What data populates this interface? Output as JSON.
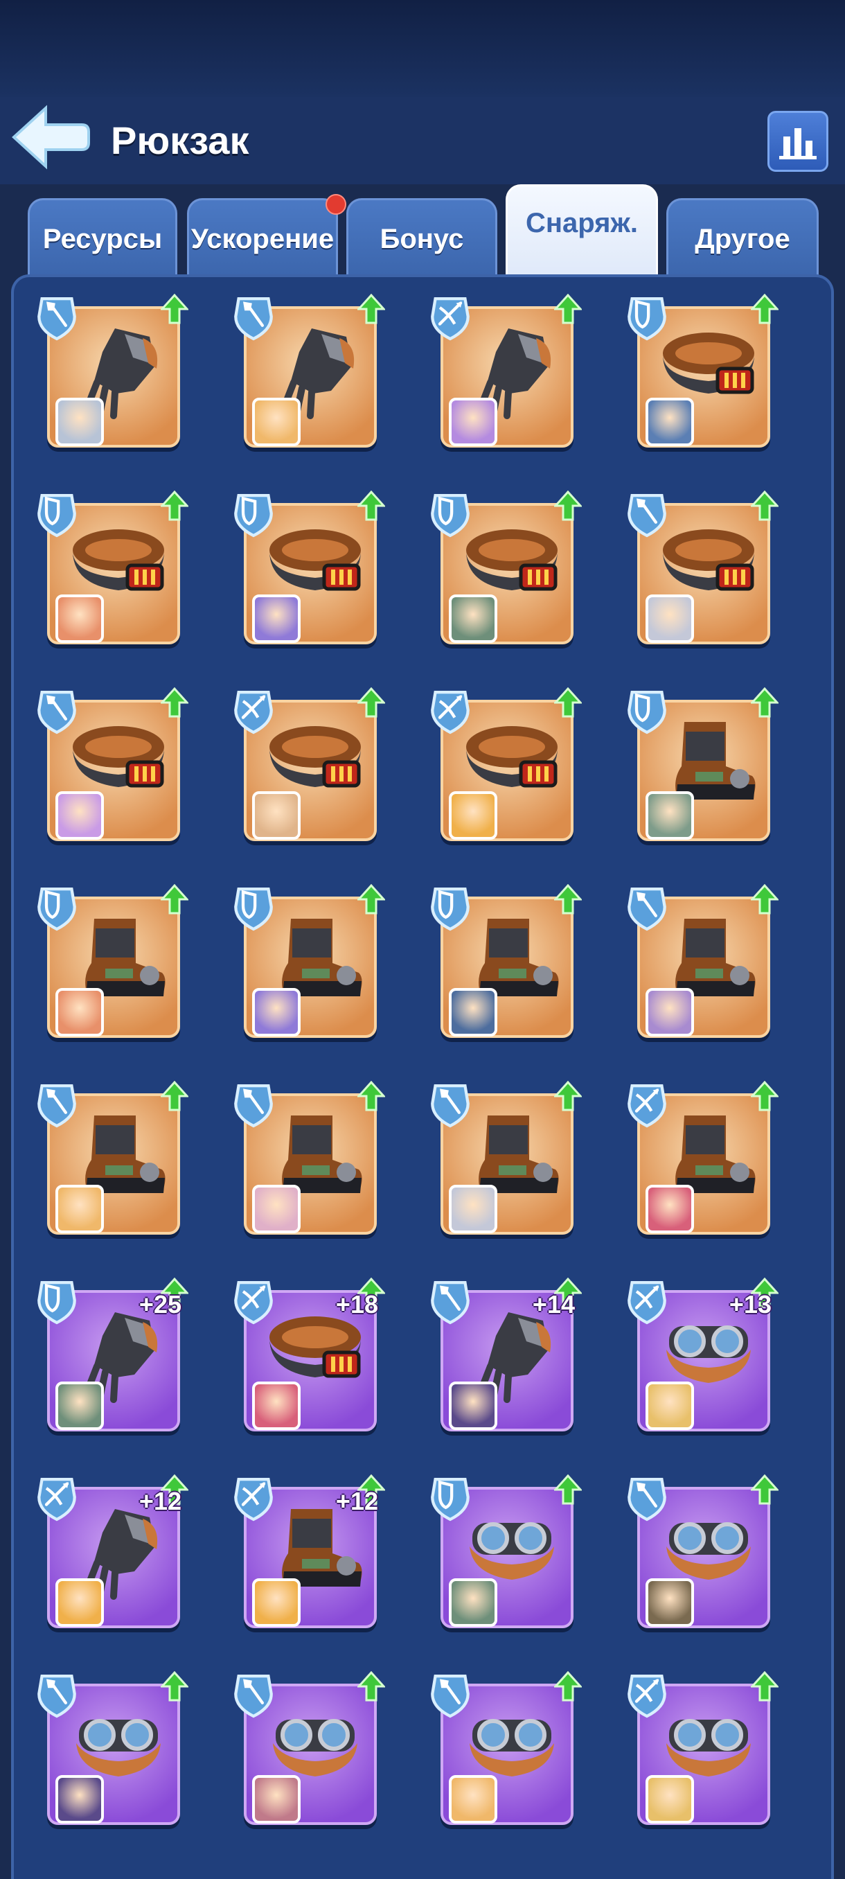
{
  "header": {
    "title": "Рюкзак"
  },
  "tabs": [
    {
      "label": "Ресурсы",
      "active": false,
      "notify": false
    },
    {
      "label": "Ускорение",
      "active": false,
      "notify": true
    },
    {
      "label": "Бонус",
      "active": false,
      "notify": false
    },
    {
      "label": "Снаряж.",
      "active": true,
      "notify": false
    },
    {
      "label": "Другое",
      "active": false,
      "notify": false
    }
  ],
  "colors": {
    "orange_card": "#dc8d4c",
    "purple_card": "#8a4bd8",
    "upgrade_arrow": "#3fc83a",
    "badge": "#5aa0dc",
    "notify_dot": "#e23b30"
  },
  "items": [
    {
      "rarity": "orange",
      "class": "shovel-icon",
      "item": "gauntlet",
      "avatar": "#b7c3d6",
      "plus": ""
    },
    {
      "rarity": "orange",
      "class": "shovel-icon",
      "item": "gauntlet",
      "avatar": "#f0b86a",
      "plus": ""
    },
    {
      "rarity": "orange",
      "class": "crossbow-icon",
      "item": "gauntlet",
      "avatar": "#b48be0",
      "plus": ""
    },
    {
      "rarity": "orange",
      "class": "shield-icon",
      "item": "belt",
      "avatar": "#5b7fb4",
      "plus": ""
    },
    {
      "rarity": "orange",
      "class": "shield-icon",
      "item": "belt",
      "avatar": "#e8906a",
      "plus": ""
    },
    {
      "rarity": "orange",
      "class": "shield-icon",
      "item": "belt",
      "avatar": "#8f7ad8",
      "plus": ""
    },
    {
      "rarity": "orange",
      "class": "shield-icon",
      "item": "belt",
      "avatar": "#6e8f7a",
      "plus": ""
    },
    {
      "rarity": "orange",
      "class": "shovel-icon",
      "item": "belt",
      "avatar": "#c4c8d8",
      "plus": ""
    },
    {
      "rarity": "orange",
      "class": "shovel-icon",
      "item": "belt",
      "avatar": "#c99be6",
      "plus": ""
    },
    {
      "rarity": "orange",
      "class": "crossbow-icon",
      "item": "belt",
      "avatar": "#e0b48a",
      "plus": ""
    },
    {
      "rarity": "orange",
      "class": "crossbow-icon",
      "item": "belt",
      "avatar": "#f0b04a",
      "plus": ""
    },
    {
      "rarity": "orange",
      "class": "shield-icon",
      "item": "boot",
      "avatar": "#7e9c8a",
      "plus": ""
    },
    {
      "rarity": "orange",
      "class": "shield-icon",
      "item": "boot",
      "avatar": "#e8906a",
      "plus": ""
    },
    {
      "rarity": "orange",
      "class": "shield-icon",
      "item": "boot",
      "avatar": "#8f7ad8",
      "plus": ""
    },
    {
      "rarity": "orange",
      "class": "shield-icon",
      "item": "boot",
      "avatar": "#4d6d9e",
      "plus": ""
    },
    {
      "rarity": "orange",
      "class": "shovel-icon",
      "item": "boot",
      "avatar": "#a88bd0",
      "plus": ""
    },
    {
      "rarity": "orange",
      "class": "shovel-icon",
      "item": "boot",
      "avatar": "#f0b86a",
      "plus": ""
    },
    {
      "rarity": "orange",
      "class": "shovel-icon",
      "item": "boot",
      "avatar": "#e0b0c8",
      "plus": ""
    },
    {
      "rarity": "orange",
      "class": "shovel-icon",
      "item": "boot",
      "avatar": "#c4c8d8",
      "plus": ""
    },
    {
      "rarity": "orange",
      "class": "crossbow-icon",
      "item": "boot",
      "avatar": "#d8607a",
      "plus": ""
    },
    {
      "rarity": "purple",
      "class": "shield-icon",
      "item": "gauntlet",
      "avatar": "#6e8f7a",
      "plus": "+25"
    },
    {
      "rarity": "purple",
      "class": "crossbow-icon",
      "item": "belt",
      "avatar": "#d8607a",
      "plus": "+18"
    },
    {
      "rarity": "purple",
      "class": "shovel-icon",
      "item": "gauntlet",
      "avatar": "#5a4a8a",
      "plus": "+14"
    },
    {
      "rarity": "purple",
      "class": "crossbow-icon",
      "item": "goggles",
      "avatar": "#e8c06a",
      "plus": "+13"
    },
    {
      "rarity": "purple",
      "class": "crossbow-icon",
      "item": "gauntlet",
      "avatar": "#f0b04a",
      "plus": "+12"
    },
    {
      "rarity": "purple",
      "class": "crossbow-icon",
      "item": "boot",
      "avatar": "#f0b04a",
      "plus": "+12"
    },
    {
      "rarity": "purple",
      "class": "shield-icon",
      "item": "goggles",
      "avatar": "#6e8f7a",
      "plus": ""
    },
    {
      "rarity": "purple",
      "class": "shovel-icon",
      "item": "goggles",
      "avatar": "#7a6a50",
      "plus": ""
    },
    {
      "rarity": "purple",
      "class": "shovel-icon",
      "item": "goggles",
      "avatar": "#5a4a8a",
      "plus": ""
    },
    {
      "rarity": "purple",
      "class": "shovel-icon",
      "item": "goggles",
      "avatar": "#c07a8a",
      "plus": ""
    },
    {
      "rarity": "purple",
      "class": "shovel-icon",
      "item": "goggles",
      "avatar": "#f0b86a",
      "plus": ""
    },
    {
      "rarity": "purple",
      "class": "crossbow-icon",
      "item": "goggles",
      "avatar": "#e8c06a",
      "plus": ""
    }
  ]
}
